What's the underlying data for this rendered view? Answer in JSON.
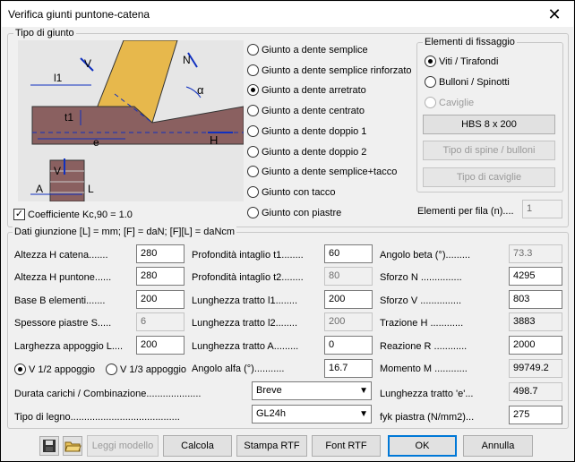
{
  "window": {
    "title": "Verifica giunti puntone-catena",
    "close_glyph": "✕"
  },
  "tipo_giunto": {
    "label": "Tipo di giunto",
    "options": [
      {
        "label": "Giunto a dente semplice",
        "selected": false
      },
      {
        "label": "Giunto a dente semplice rinforzato",
        "selected": false
      },
      {
        "label": "Giunto a dente arretrato",
        "selected": true
      },
      {
        "label": "Giunto a dente centrato",
        "selected": false
      },
      {
        "label": "Giunto a dente doppio 1",
        "selected": false
      },
      {
        "label": "Giunto a dente doppio 2",
        "selected": false
      },
      {
        "label": "Giunto a dente semplice+tacco",
        "selected": false
      },
      {
        "label": "Giunto con tacco",
        "selected": false
      },
      {
        "label": "Giunto con piastre",
        "selected": false
      }
    ],
    "diagram_labels": {
      "l1": "l1",
      "t1": "t1",
      "e": "e",
      "V_top": "V",
      "N": "N",
      "alpha": "α",
      "H": "H",
      "V_bottom": "V",
      "A": "A",
      "L": "L"
    }
  },
  "elementi_fissaggio": {
    "label": "Elementi di fissaggio",
    "options": [
      {
        "label": "Viti / Tirafondi",
        "selected": true,
        "disabled": false
      },
      {
        "label": "Bulloni / Spinotti",
        "selected": false,
        "disabled": false
      },
      {
        "label": "Caviglie",
        "selected": false,
        "disabled": true
      }
    ],
    "btn_hbs": "HBS  8  x 200",
    "btn_spine": "Tipo di spine / bulloni",
    "btn_caviglie": "Tipo di caviglie"
  },
  "coefficiente": {
    "label": "Coefficiente Kc,90 = 1.0",
    "checked": true,
    "mark": "✓"
  },
  "elementi_per_fila": {
    "label": "Elementi per fila (n)....",
    "value": "1"
  },
  "dati": {
    "label": "Dati giunzione [L] = mm; [F] = daN; [F][L] = daNcm",
    "col1": [
      {
        "label": "Altezza H catena.......",
        "value": "280",
        "ro": false
      },
      {
        "label": "Altezza H puntone......",
        "value": "280",
        "ro": false
      },
      {
        "label": "Base B elementi.......",
        "value": "200",
        "ro": false
      },
      {
        "label": "Spessore piastre S.....",
        "value": "6",
        "ro": true
      },
      {
        "label": "Larghezza appoggio L....",
        "value": "200",
        "ro": false
      }
    ],
    "col2": [
      {
        "label": "Profondità intaglio t1........",
        "value": "60",
        "ro": false
      },
      {
        "label": "Profondità intaglio t2........",
        "value": "80",
        "ro": true
      },
      {
        "label": "Lunghezza tratto l1........",
        "value": "200",
        "ro": false
      },
      {
        "label": "Lunghezza tratto l2........",
        "value": "200",
        "ro": true
      },
      {
        "label": "Lunghezza tratto A.........",
        "value": "0",
        "ro": false
      },
      {
        "label": "Angolo alfa (°)...........",
        "value": "16.7",
        "ro": false
      }
    ],
    "col3": [
      {
        "label": "Angolo beta (°).........",
        "value": "73.3",
        "ro": true
      },
      {
        "label": "Sforzo N ...............",
        "value": "4295",
        "ro": false
      },
      {
        "label": "Sforzo V ...............",
        "value": "803",
        "ro": false
      },
      {
        "label": "Trazione H ............",
        "value": "3883",
        "ro": true
      },
      {
        "label": "Reazione R ............",
        "value": "2000",
        "ro": false
      },
      {
        "label": "Momento M ............",
        "value": "99749.2",
        "ro": true
      },
      {
        "label": "Lunghezza tratto 'e'...",
        "value": "498.7",
        "ro": true
      },
      {
        "label": "fyk piastra (N/mm2)...",
        "value": "275",
        "ro": false
      }
    ],
    "appoggio": [
      {
        "label": "V 1/2 appoggio",
        "selected": true
      },
      {
        "label": "V 1/3 appoggio",
        "selected": false
      }
    ],
    "durata": {
      "label": "Durata carichi / Combinazione....................",
      "value": "Breve"
    },
    "legno": {
      "label": "Tipo di legno........................................",
      "value": "GL24h"
    }
  },
  "footer": {
    "btn_leggi": "Leggi modello",
    "btn_calcola": "Calcola",
    "btn_stampa": "Stampa RTF",
    "btn_font": "Font RTF",
    "btn_ok": "OK",
    "btn_annulla": "Annulla"
  }
}
